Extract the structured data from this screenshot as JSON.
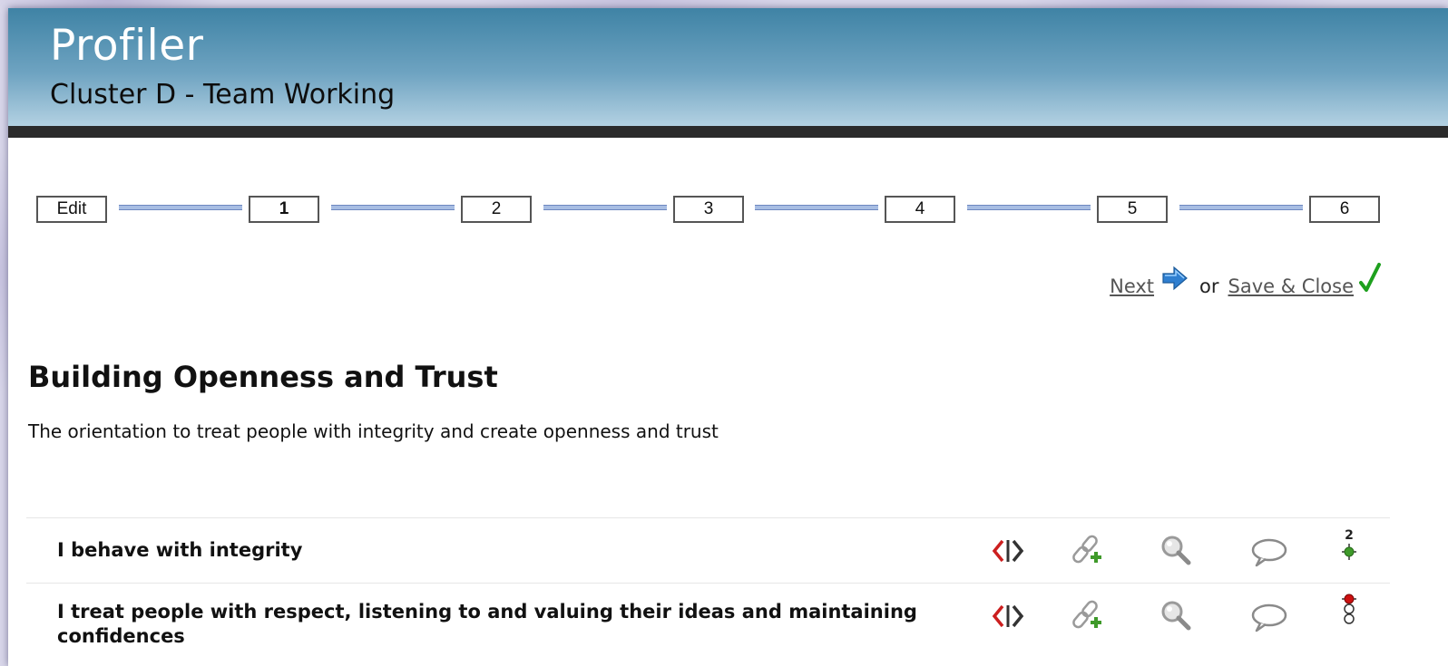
{
  "header": {
    "app_title": "Profiler",
    "cluster_title": "Cluster D - Team Working"
  },
  "steps": [
    {
      "label": "Edit",
      "current": false
    },
    {
      "label": "1",
      "current": true
    },
    {
      "label": "2",
      "current": false
    },
    {
      "label": "3",
      "current": false
    },
    {
      "label": "4",
      "current": false
    },
    {
      "label": "5",
      "current": false
    },
    {
      "label": "6",
      "current": false
    }
  ],
  "nav": {
    "next_label": "Next",
    "or_text": "or",
    "save_close_label": "Save & Close"
  },
  "section": {
    "title": "Building Openness and Trust",
    "description": "The orientation to treat people with integrity and create openness and trust"
  },
  "items": [
    {
      "text": "I behave with integrity",
      "score": "2",
      "status_light": "green",
      "icons": [
        "compare-icon",
        "link-add-icon",
        "magnifier-icon",
        "comment-icon",
        "score-indicator-icon"
      ]
    },
    {
      "text": "I treat people with respect, listening to and valuing their ideas and maintaining confidences",
      "score": "",
      "status_light": "red",
      "icons": [
        "compare-icon",
        "link-add-icon",
        "magnifier-icon",
        "comment-icon",
        "traffic-light-icon"
      ]
    }
  ],
  "colors": {
    "header_top": "#3f83a5",
    "header_bottom": "#b3d1e2",
    "dark_band": "#2b2b2b",
    "connector": "#a7bde3",
    "compare_red": "#cc1f1f",
    "status_green": "#3f9a2a",
    "status_red": "#cc1010",
    "check_green": "#1ea01e",
    "arrow_blue": "#2f7fd0"
  }
}
